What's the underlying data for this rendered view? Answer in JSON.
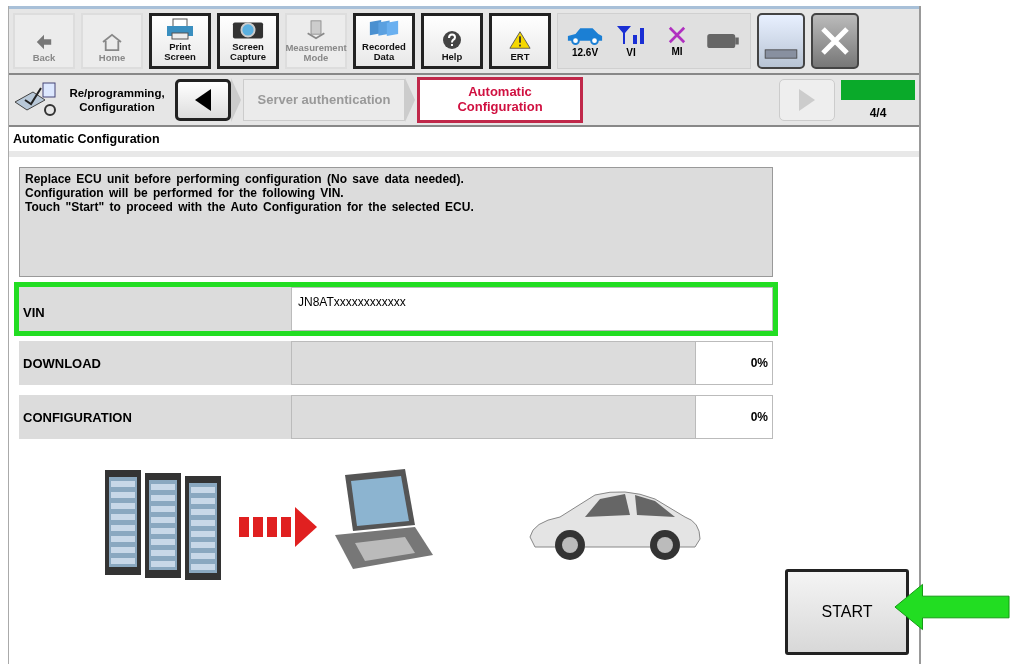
{
  "toolbar": [
    {
      "kind": "back",
      "label": "Back",
      "disabled": true
    },
    {
      "kind": "home",
      "label": "Home",
      "disabled": true
    },
    {
      "kind": "printer",
      "label": "Print Screen",
      "disabled": false
    },
    {
      "kind": "camera",
      "label": "Screen Capture",
      "disabled": false
    },
    {
      "kind": "meter",
      "label": "Measurement Mode",
      "disabled": true
    },
    {
      "kind": "folders",
      "label": "Recorded Data",
      "disabled": false
    },
    {
      "kind": "help",
      "label": "Help",
      "disabled": false
    },
    {
      "kind": "warning",
      "label": "ERT",
      "disabled": false
    }
  ],
  "status": [
    {
      "kind": "car",
      "label": "12.6V"
    },
    {
      "kind": "signal",
      "label": "VI"
    },
    {
      "kind": "cross",
      "label": "MI"
    },
    {
      "kind": "battery"
    }
  ],
  "breadcrumb": {
    "label": "Re/programming, Configuration",
    "steps": [
      {
        "label": "Server authentication",
        "selected": false
      },
      {
        "label": "Automatic Configuration",
        "selected": true
      }
    ],
    "progress": {
      "level": 1,
      "reading": "4/4"
    }
  },
  "title": "Automatic Configuration",
  "message": [
    "Replace ECU unit before performing configuration (No save data needed).",
    "Configuration will be performed for the following VIN.",
    "Touch \"Start\" to proceed with the Auto Configuration for the selected ECU."
  ],
  "vin": {
    "label": "VIN",
    "value": "JN8ATxxxxxxxxxxxx",
    "highlighted": true
  },
  "rows": [
    {
      "label": "DOWNLOAD",
      "level": 0,
      "reading": "0%"
    },
    {
      "label": "CONFIGURATION",
      "level": 0,
      "reading": "0%"
    }
  ],
  "start": {
    "label": "START",
    "pointed": true
  }
}
